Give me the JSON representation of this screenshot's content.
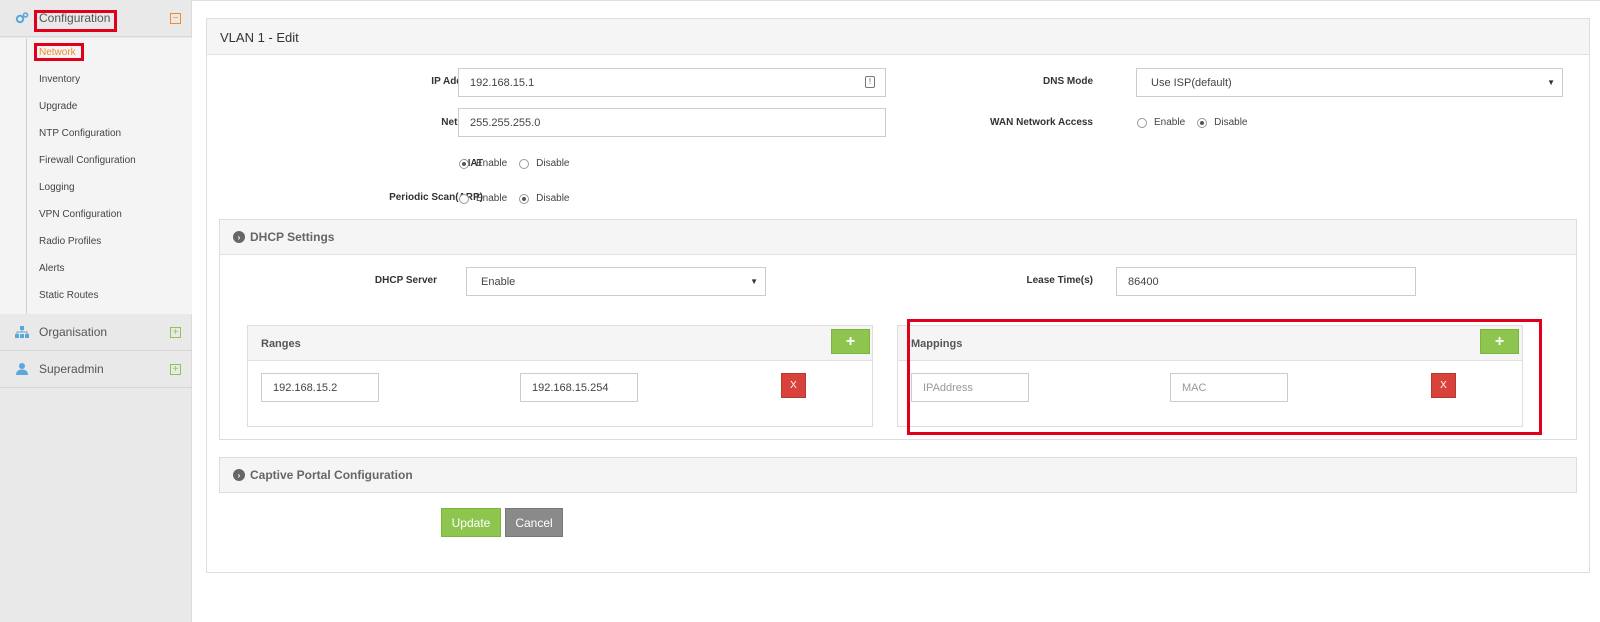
{
  "sidebar": {
    "configuration": {
      "label": "Configuration",
      "toggle": "−"
    },
    "items": [
      {
        "label": "Network"
      },
      {
        "label": "Inventory"
      },
      {
        "label": "Upgrade"
      },
      {
        "label": "NTP Configuration"
      },
      {
        "label": "Firewall Configuration"
      },
      {
        "label": "Logging"
      },
      {
        "label": "VPN Configuration"
      },
      {
        "label": "Radio Profiles"
      },
      {
        "label": "Alerts"
      },
      {
        "label": "Static Routes"
      }
    ],
    "organisation": {
      "label": "Organisation",
      "toggle": "+"
    },
    "superadmin": {
      "label": "Superadmin",
      "toggle": "+"
    }
  },
  "panel": {
    "title": "VLAN 1 - Edit",
    "ip_address": {
      "label": "IP Address",
      "value": "192.168.15.1"
    },
    "netmask": {
      "label": "Netmask",
      "value": "255.255.255.0"
    },
    "nat": {
      "label": "NAT",
      "options": [
        "Enable",
        "Disable"
      ],
      "selected": "Enable"
    },
    "periodic_scan": {
      "label": "Periodic Scan(ARP)",
      "options": [
        "Enable",
        "Disable"
      ],
      "selected": "Disable"
    },
    "dns_mode": {
      "label": "DNS Mode",
      "value": "Use ISP(default)"
    },
    "wan_access": {
      "label": "WAN Network Access",
      "options": [
        "Enable",
        "Disable"
      ],
      "selected": "Disable"
    }
  },
  "dhcp": {
    "title": "DHCP Settings",
    "server": {
      "label": "DHCP Server",
      "value": "Enable"
    },
    "lease": {
      "label": "Lease Time(s)",
      "value": "86400"
    },
    "ranges": {
      "title": "Ranges",
      "plus": "+",
      "start": "192.168.15.2",
      "end": "192.168.15.254",
      "remove": "X"
    },
    "mappings": {
      "title": "Mappings",
      "plus": "+",
      "ip_placeholder": "IPAddress",
      "mac_placeholder": "MAC",
      "remove": "X"
    }
  },
  "captive": {
    "title": "Captive Portal Configuration"
  },
  "actions": {
    "update": "Update",
    "cancel": "Cancel"
  },
  "colors": {
    "accent_green": "#8dc54f",
    "danger_red": "#d9423a",
    "highlight_red": "#e0001b",
    "active_orange": "#f28b30",
    "icon_blue": "#5aa7d9"
  }
}
